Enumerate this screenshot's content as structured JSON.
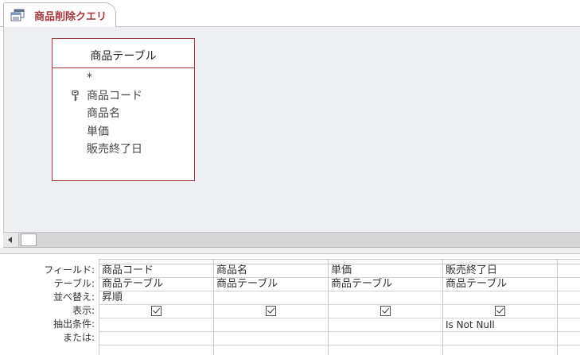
{
  "tab": {
    "title": "商品削除クエリ",
    "icon": "query-icon"
  },
  "table": {
    "title": "商品テーブル",
    "fields": [
      {
        "label": "*",
        "key": false
      },
      {
        "label": "商品コード",
        "key": true
      },
      {
        "label": "商品名",
        "key": false
      },
      {
        "label": "単価",
        "key": false
      },
      {
        "label": "販売終了日",
        "key": false
      }
    ]
  },
  "grid": {
    "row_labels": {
      "field": "フィールド:",
      "table": "テーブル:",
      "sort": "並べ替え:",
      "show": "表示:",
      "criteria": "抽出条件:",
      "or": "または:"
    },
    "columns": [
      {
        "field": "商品コード",
        "table": "商品テーブル",
        "sort": "昇順",
        "show": true,
        "criteria": "",
        "or": ""
      },
      {
        "field": "商品名",
        "table": "商品テーブル",
        "sort": "",
        "show": true,
        "criteria": "",
        "or": ""
      },
      {
        "field": "単価",
        "table": "商品テーブル",
        "sort": "",
        "show": true,
        "criteria": "",
        "or": ""
      },
      {
        "field": "販売終了日",
        "table": "商品テーブル",
        "sort": "",
        "show": true,
        "criteria": "Is Not Null",
        "or": ""
      }
    ]
  },
  "colors": {
    "accent": "#a4373a",
    "pane_background": "#eeeff2"
  }
}
